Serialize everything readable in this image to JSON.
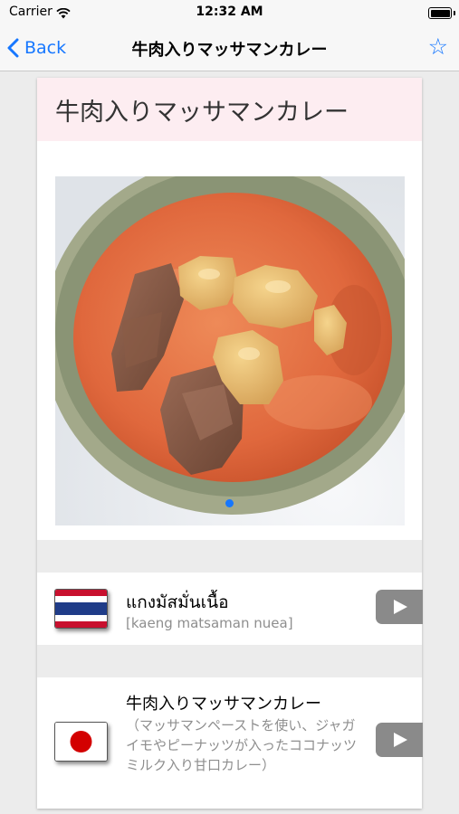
{
  "status_bar": {
    "carrier": "Carrier",
    "time": "12:32 AM"
  },
  "nav": {
    "back_label": "Back",
    "title": "牛肉入りマッサマンカレー",
    "favorite_icon": "☆"
  },
  "card": {
    "title": "牛肉入りマッサマンカレー",
    "photo": {
      "subject": "massaman-curry-photo",
      "page_count": 1,
      "current_page": 1
    },
    "entries": [
      {
        "language": "Thai",
        "flag_icon": "thailand-flag-icon",
        "name": "แกงมัสมั่นเนื้อ",
        "romanization": "[kaeng matsaman nuea]"
      },
      {
        "language": "Japanese",
        "flag_icon": "japan-flag-icon",
        "name": "牛肉入りマッサマンカレー",
        "description": "（マッサマンペーストを使い、ジャガイモやピーナッツが入ったココナッツミルク入り甘口カレー）"
      }
    ]
  },
  "colors": {
    "accent": "#1677ff",
    "header_bg": "#fdedf1",
    "play_button": "#8a8a8a",
    "secondary_text": "#8e8e8e"
  }
}
